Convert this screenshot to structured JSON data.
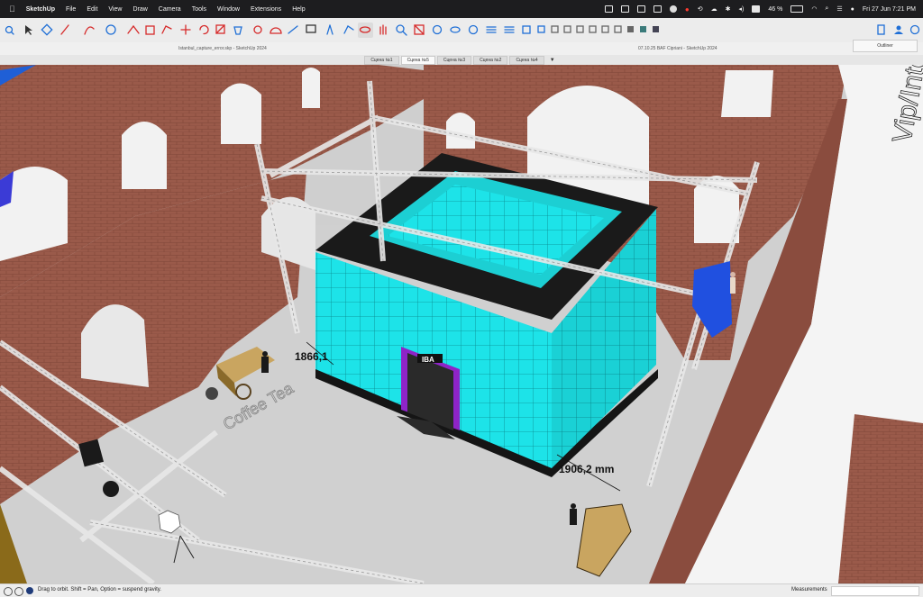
{
  "menubar": {
    "app_name": "SketchUp",
    "items": [
      "File",
      "Edit",
      "View",
      "Draw",
      "Camera",
      "Tools",
      "Window",
      "Extensions",
      "Help"
    ],
    "battery": "46 %",
    "clock": "Fri 27 Jun  7:21 PM"
  },
  "window": {
    "title_left": "Istanbul_capture_error.skp - SketchUp 2024",
    "title_right": "07.10.25 BAF Cipriani - SketchUp 2024",
    "outliner_label": "Outliner"
  },
  "scenes": [
    "Сцена №1",
    "Сцена №5",
    "Сцена №3",
    "Сцена №2",
    "Сцена №4"
  ],
  "active_scene": "Сцена №5",
  "scene_menu_arrow": "▼",
  "viewport": {
    "dimension_left": "1866,1",
    "dimension_right": "1906,2 mm",
    "booth_logo": "IBA",
    "floor_text": "Coffee Tea",
    "sign_text": "Vip/Interview Re"
  },
  "colors": {
    "screen_cyan": "#1de3e8",
    "frame_purple": "#8e24c8",
    "brick": "#9a5a4a",
    "floor": "#d0d0d0"
  },
  "status": {
    "hint": "Drag to orbit. Shift = Pan, Option = suspend gravity.",
    "measurements_label": "Measurements"
  }
}
